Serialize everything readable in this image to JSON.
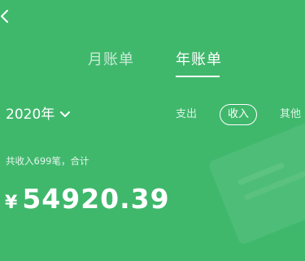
{
  "nav": {
    "back_icon": "chevron-left-icon"
  },
  "tabs": [
    {
      "label": "月账单",
      "active": false
    },
    {
      "label": "年账单",
      "active": true
    }
  ],
  "year_selector": {
    "label": "2020年",
    "icon": "chevron-down-icon"
  },
  "filters": [
    {
      "label": "支出",
      "selected": false
    },
    {
      "label": "收入",
      "selected": true
    },
    {
      "label": "其他",
      "selected": false
    }
  ],
  "summary": {
    "text": "共收入699笔，合计",
    "currency": "¥",
    "amount": "54920.39"
  },
  "colors": {
    "background": "#3fb86c",
    "text": "#ffffff"
  }
}
